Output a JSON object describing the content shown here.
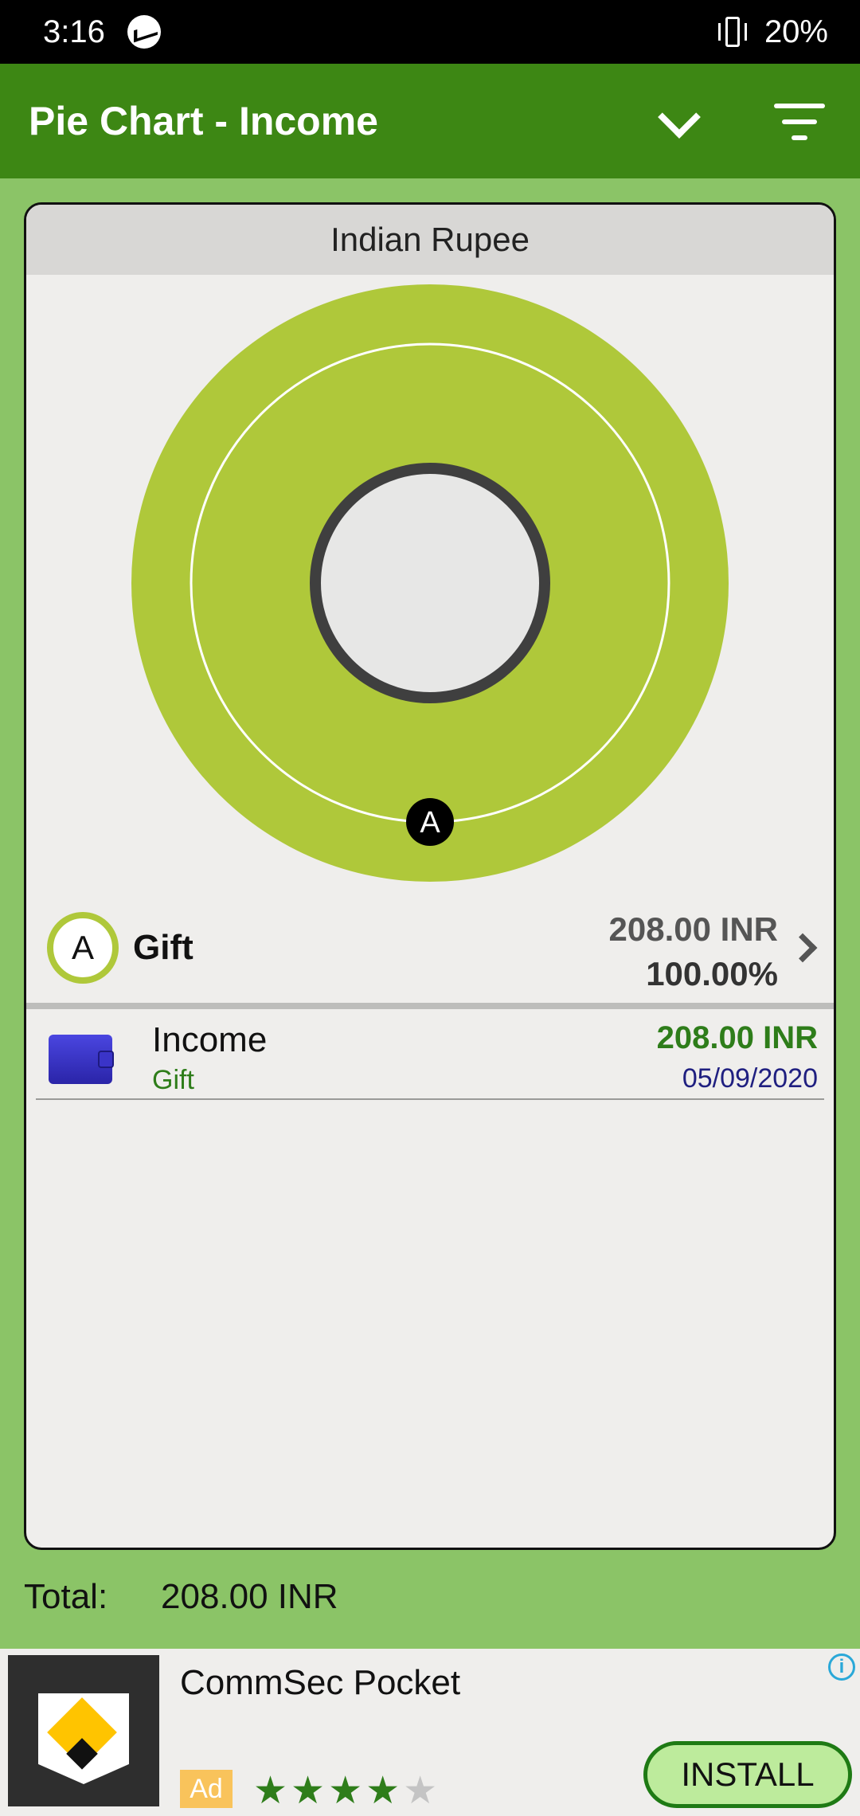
{
  "status_bar": {
    "time": "3:16",
    "battery": "20%"
  },
  "app_bar": {
    "title": "Pie Chart - Income"
  },
  "card": {
    "currency": "Indian Rupee",
    "legend": {
      "marker": "A",
      "label": "Gift",
      "amount": "208.00 INR",
      "percent": "100.00%",
      "color": "#AFC83A"
    },
    "transaction": {
      "title": "Income",
      "category": "Gift",
      "amount": "208.00 INR",
      "date": "05/09/2020"
    }
  },
  "chart_data": {
    "type": "pie",
    "categories": [
      "Gift"
    ],
    "values": [
      208.0
    ],
    "labels": [
      "A"
    ],
    "colors": [
      "#AFC83A"
    ]
  },
  "total": {
    "label": "Total:",
    "value": "208.00 INR"
  },
  "ad": {
    "title": "CommSec Pocket",
    "badge": "Ad",
    "rating": 4,
    "install_label": "INSTALL"
  }
}
